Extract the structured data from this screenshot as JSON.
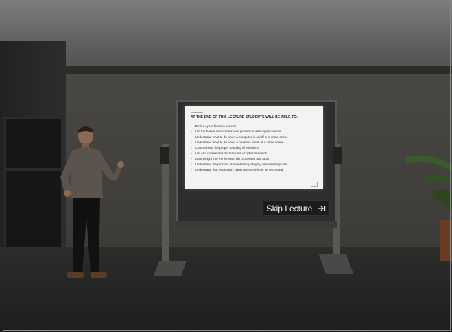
{
  "scene": {
    "slide": {
      "heading": "AT THE END OF THIS LECTURE STUDENTS WILL BE ABLE TO:",
      "bullets": [
        "Define cyber forensic science",
        "List the basics of a crime scene procedure with digital devices",
        "Understand what to do when a computer is on/off at a crime scene",
        "Understand what to do when a phone is on/off at a crime scene",
        "Comprehend the proper handling of evidence",
        "List and understand the three A's of cyber forensics",
        "Gain insight into the forensic lab processes and tools",
        "Understand the process of maintaining integrity of evidentiary data",
        "Understand that evidentiary data may sometimes be encrypted"
      ]
    },
    "skip_button": {
      "label": "Skip Lecture",
      "icon": "arrow-to-right-icon"
    },
    "colors": {
      "skip_bg": "#1c1c1c",
      "slide_bg": "#f3f3f1",
      "wall": "#4a4843"
    }
  }
}
